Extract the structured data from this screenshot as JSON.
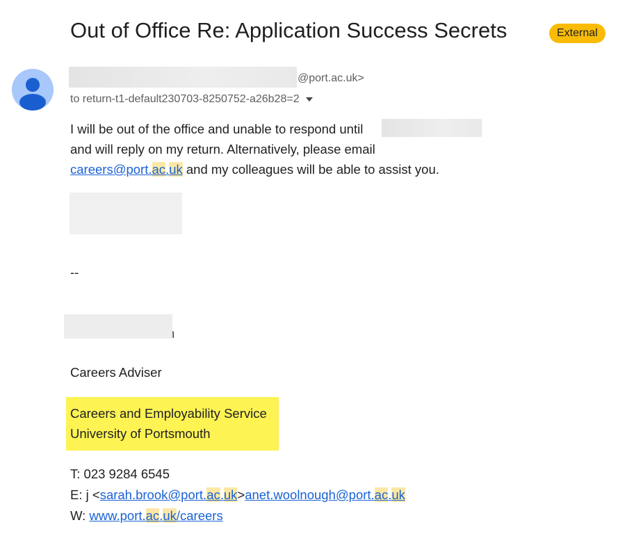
{
  "email": {
    "subject": "Out of Office Re: Application Success Secrets",
    "external_badge": "External",
    "sender_domain": "@port.ac.uk>",
    "recipient": "to return-t1-default230703-8250752-a26b28=2",
    "body": {
      "line1": "I will be out of the office and unable to respond until",
      "line2": "and will reply on my return.  Alternatively, please email",
      "line3_link_pre": "careers@port.",
      "line3_link_hl1": "ac",
      "line3_link_dot": ".",
      "line3_link_hl2": "uk",
      "line3_post": " and my colleagues will be able to assist you."
    },
    "signature": {
      "separator": "--",
      "name_tail": "h",
      "role": "Careers Adviser",
      "dept": "Careers and Employability Service",
      "org": "University of Portsmouth",
      "phone": "T: 023 9284 6545",
      "email_prefix": "E: j <",
      "email1_pre": "sarah.brook@port.",
      "email1_hl1": "ac",
      "email1_dot": ".",
      "email1_hl2": "uk",
      "email_sep": ">",
      "email2_pre": "anet.woolnough@port.",
      "email2_hl1": "ac",
      "email2_dot": ".",
      "email2_hl2": "uk",
      "web_prefix": "W: ",
      "web_pre": "www.port.",
      "web_hl1": "ac",
      "web_dot": ".",
      "web_hl2": "uk",
      "web_post": "/careers"
    }
  },
  "colors": {
    "badge": "#f9bb06",
    "highlight": "#fdf353",
    "link": "#1a62d6",
    "avatar_bg": "#a8c7fa",
    "avatar_fg": "#0b57d0"
  }
}
